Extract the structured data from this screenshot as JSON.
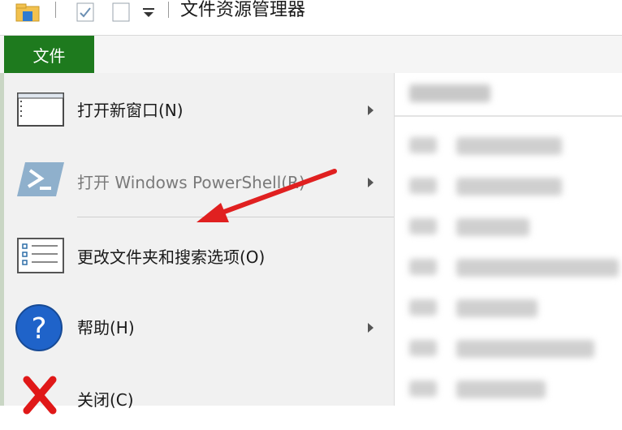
{
  "window": {
    "title": "文件资源管理器"
  },
  "ribbon": {
    "file_tab": "文件"
  },
  "menu": {
    "items": [
      {
        "label": "打开新窗口(N)",
        "has_submenu": true,
        "disabled": false,
        "icon": "new-window-icon"
      },
      {
        "label": "打开 Windows PowerShell(R)",
        "has_submenu": true,
        "disabled": true,
        "icon": "powershell-icon"
      },
      {
        "label": "更改文件夹和搜索选项(O)",
        "has_submenu": false,
        "disabled": false,
        "icon": "folder-options-icon"
      },
      {
        "label": "帮助(H)",
        "has_submenu": true,
        "disabled": false,
        "icon": "help-icon"
      },
      {
        "label": "关闭(C)",
        "has_submenu": false,
        "disabled": false,
        "icon": "close-icon"
      }
    ]
  },
  "colors": {
    "file_tab": "#1e7a1e",
    "annotation_arrow": "#e02020",
    "powershell": "#2f6fa8",
    "help": "#1f63c9",
    "close": "#e01818"
  }
}
